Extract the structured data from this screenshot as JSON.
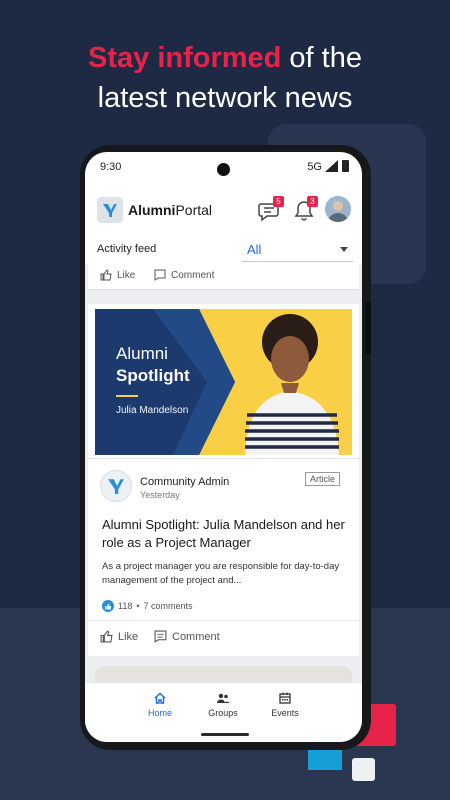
{
  "headline": {
    "accent": "Stay informed",
    "line1_rest": " of the",
    "line2": "latest network news"
  },
  "status_bar": {
    "time": "9:30",
    "network": "5G"
  },
  "app": {
    "name_bold": "Alumni",
    "name_regular": "Portal",
    "messages_count": "5",
    "notifications_count": "3"
  },
  "filter": {
    "label": "Activity feed",
    "value": "All"
  },
  "previous_card": {
    "like": "Like",
    "comment": "Comment"
  },
  "post": {
    "banner_line1": "Alumni",
    "banner_line2": "Spotlight",
    "banner_name": "Julia Mandelson",
    "author": "Community Admin",
    "time": "Yesterday",
    "tag": "Article",
    "title": "Alumni Spotlight: Julia Mandelson and her role as a Project Manager",
    "body": "As a project manager you are responsible for day-to-day management of the project and...",
    "likes": "118",
    "separator": "•",
    "comments": "7 comments",
    "like_label": "Like",
    "comment_label": "Comment"
  },
  "bottom_nav": [
    {
      "label": "Home",
      "icon": "home-icon",
      "active": true
    },
    {
      "label": "Groups",
      "icon": "groups-icon",
      "active": false
    },
    {
      "label": "Events",
      "icon": "calendar-icon",
      "active": false
    }
  ],
  "colors": {
    "accent": "#e8234a",
    "brand_blue": "#1b6bd8",
    "background": "#1e2a44",
    "banner_navy": "#1d3a6e",
    "banner_yellow": "#f9cf45"
  }
}
